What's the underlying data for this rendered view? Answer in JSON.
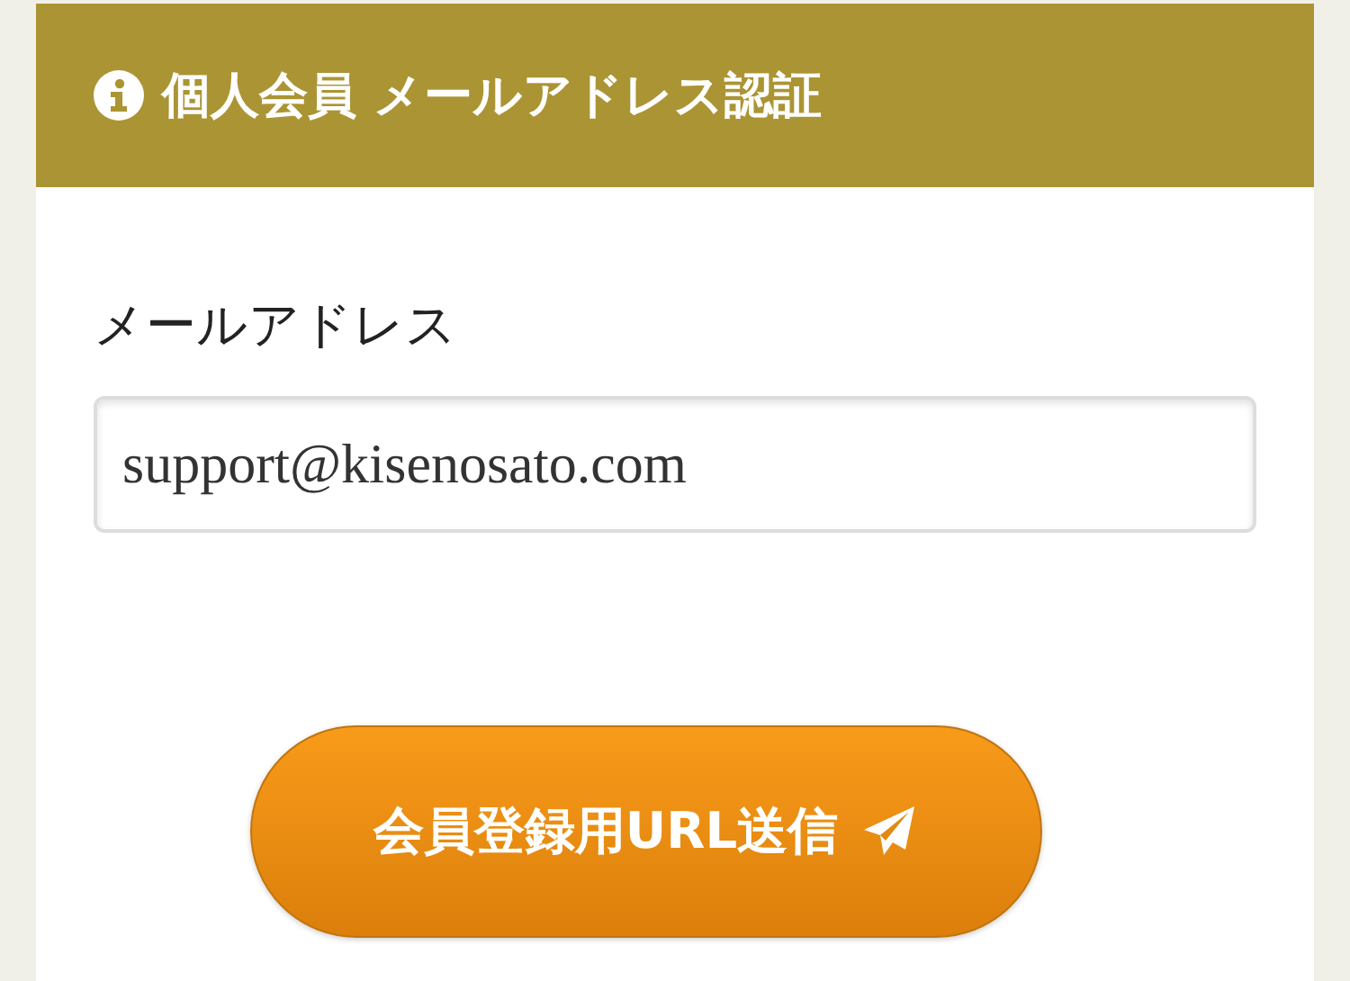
{
  "header": {
    "title": "個人会員 メールアドレス認証"
  },
  "form": {
    "label": "メールアドレス",
    "email": {
      "value": "support@kisenosato.com"
    }
  },
  "submit_button": {
    "label": "会員登録用URL送信"
  }
}
